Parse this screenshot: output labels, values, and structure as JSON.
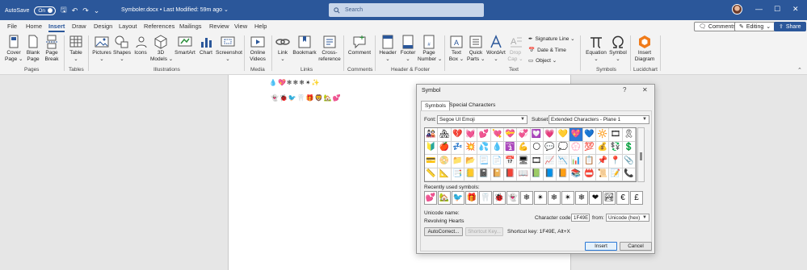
{
  "titlebar": {
    "autosave_label": "AutoSave",
    "autosave_state": "On",
    "document_title": "Symboler.docx • Last Modified: 59m ago ⌄",
    "search_placeholder": "Search",
    "undo_icon": "↶",
    "redo_icon": "↷",
    "save_icon": "🖫",
    "more_icon": "⌄",
    "minimize": "—",
    "restore": "☐",
    "close": "✕"
  },
  "tabs": [
    "File",
    "Home",
    "Insert",
    "Draw",
    "Design",
    "Layout",
    "References",
    "Mailings",
    "Review",
    "View",
    "Help"
  ],
  "active_tab": "Insert",
  "ribbon_right": {
    "comments": "Comments",
    "editing": "Editing",
    "share": "Share"
  },
  "ribbon": {
    "pages": {
      "label": "Pages",
      "cover_page": "Cover\nPage ⌄",
      "blank_page": "Blank\nPage",
      "page_break": "Page\nBreak"
    },
    "tables": {
      "label": "Tables",
      "table": "Table\n⌄"
    },
    "illustrations": {
      "label": "Illustrations",
      "pictures": "Pictures\n⌄",
      "shapes": "Shapes\n⌄",
      "icons": "Icons",
      "models_3d": "3D\nModels ⌄",
      "smartart": "SmartArt",
      "chart": "Chart",
      "screenshot": "Screenshot\n⌄"
    },
    "media": {
      "label": "Media",
      "online_videos": "Online\nVideos"
    },
    "links": {
      "label": "Links",
      "link": "Link\n⌄",
      "bookmark": "Bookmark",
      "cross_reference": "Cross-\nreference"
    },
    "comments": {
      "label": "Comments",
      "comment": "Comment"
    },
    "header_footer": {
      "label": "Header & Footer",
      "header": "Header\n⌄",
      "footer": "Footer\n⌄",
      "page_number": "Page\nNumber ⌄"
    },
    "text": {
      "label": "Text",
      "text_box": "Text\nBox ⌄",
      "quick_parts": "Quick\nParts ⌄",
      "wordart": "WordArt\n⌄",
      "drop_cap": "Drop\nCap ⌄",
      "signature_line": "Signature Line ⌄",
      "date_time": "Date & Time",
      "object": "Object ⌄"
    },
    "symbols": {
      "label": "Symbols",
      "equation": "Equation\n⌄",
      "symbol": "Symbol\n⌄"
    },
    "lucidchart": {
      "label": "Lucidchart",
      "insert_diagram": "Insert\nDiagram"
    }
  },
  "document": {
    "line1": "💧💖❄❄❄✴✨",
    "line2": "👻🐞🐦🦷🎁🦁🏡💕"
  },
  "dialog": {
    "title": "Symbol",
    "help_icon": "?",
    "close_icon": "✕",
    "tabs": [
      "Symbols",
      "Special Characters"
    ],
    "font_label": "Font:",
    "font_value": "Segoe UI Emoji",
    "subset_label": "Subset:",
    "subset_value": "Extended Characters - Plane 1",
    "grid_symbols": [
      "🎎",
      "🏘",
      "💔",
      "💓",
      "💕",
      "💘",
      "💝",
      "💞",
      "💟",
      "💗",
      "💛",
      "💖",
      "💙",
      "🔆",
      "🎞",
      "🎗",
      "🔰",
      "🍎",
      "💤",
      "💥",
      "💦",
      "💧",
      "🛐",
      "💪",
      "🌕",
      "💬",
      "💭",
      "💮",
      "💯",
      "💰",
      "💱",
      "💲",
      "💳",
      "📀",
      "📁",
      "📂",
      "📃",
      "📄",
      "📅",
      "🖥",
      "🎞",
      "📈",
      "📉",
      "📊",
      "📋",
      "📌",
      "📍",
      "📎",
      "📏",
      "📐",
      "📑",
      "📒",
      "📓",
      "📔",
      "📕",
      "📖",
      "📗",
      "📘",
      "📙",
      "📚",
      "📛",
      "📜",
      "📝",
      "📞"
    ],
    "selected_index": 11,
    "recent_label": "Recently used symbols:",
    "recent_symbols": [
      "💕",
      "🏡",
      "🐦",
      "🎁",
      "🦷",
      "🐞",
      "👻",
      "❄",
      "✴",
      "❄",
      "✴",
      "❄",
      "❤",
      "🏞",
      "€",
      "£"
    ],
    "unicode_name_label": "Unicode name:",
    "unicode_name_value": "Revolving Hearts",
    "char_code_label": "Character code:",
    "char_code_value": "1F49E",
    "from_label": "from:",
    "from_value": "Unicode (hex)",
    "autocorrect": "AutoCorrect...",
    "shortcut_key_button": "Shortcut Key...",
    "shortcut_key_text": "Shortcut key: 1F49E, Alt+X",
    "insert": "Insert",
    "cancel": "Cancel"
  }
}
